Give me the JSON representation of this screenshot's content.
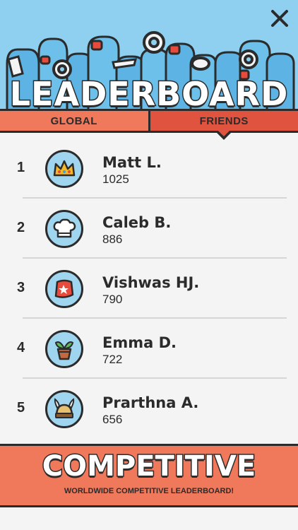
{
  "header": {
    "title": "LEADERBOARD",
    "close_icon": "close-icon"
  },
  "tabs": [
    {
      "label": "GLOBAL",
      "selected": false
    },
    {
      "label": "FRIENDS",
      "selected": true
    }
  ],
  "leaderboard": [
    {
      "rank": "1",
      "name": "Matt L.",
      "score": "1025",
      "icon": "crown-icon"
    },
    {
      "rank": "2",
      "name": "Caleb B.",
      "score": "886",
      "icon": "chef-hat-icon"
    },
    {
      "rank": "3",
      "name": "Vishwas HJ.",
      "score": "790",
      "icon": "star-badge-icon"
    },
    {
      "rank": "4",
      "name": "Emma D.",
      "score": "722",
      "icon": "plant-pot-icon"
    },
    {
      "rank": "5",
      "name": "Prarthna A.",
      "score": "656",
      "icon": "viking-helmet-icon"
    }
  ],
  "footer": {
    "title": "COMPETITIVE",
    "subtitle": "WORLDWIDE COMPETITIVE LEADERBOARD!"
  },
  "colors": {
    "sky": "#8fd0f0",
    "tab_global": "#f0795c",
    "tab_friends": "#e0533f",
    "outline": "#2b2b2b",
    "avatar_bg": "#9fd5ef"
  }
}
